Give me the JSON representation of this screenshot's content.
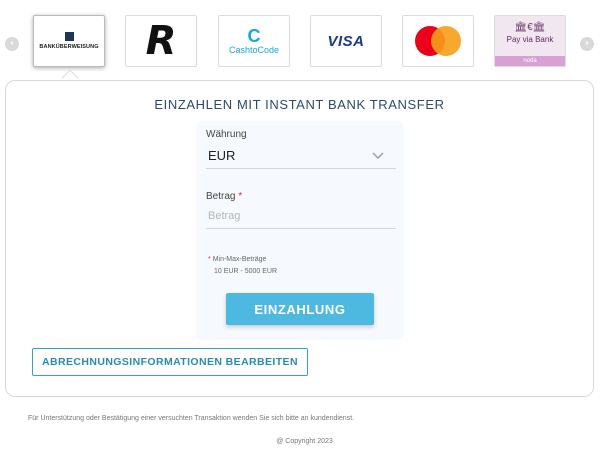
{
  "carousel": {
    "prev_glyph": "‹",
    "next_glyph": "›",
    "methods": [
      {
        "id": "bank-transfer",
        "logo_text": "BANKÜBERWEISUNG",
        "active": true
      },
      {
        "id": "revolut",
        "logo_text": "R",
        "active": false
      },
      {
        "id": "cashtocode",
        "logo_text": "CashtoCode",
        "active": false
      },
      {
        "id": "visa",
        "logo_text": "VISA",
        "active": false
      },
      {
        "id": "mastercard",
        "logo_text": "",
        "active": false
      },
      {
        "id": "pay-via-bank",
        "logo_text": "Pay via Bank",
        "sub_text": "noda",
        "active": false
      }
    ]
  },
  "form": {
    "title": "EINZAHLEN MIT INSTANT BANK TRANSFER",
    "currency_label": "Währung",
    "currency_value": "EUR",
    "amount_label": "Betrag",
    "amount_required_mark": "*",
    "amount_placeholder": "Betrag",
    "limits_mark": "*",
    "limits_title": "Min-Max-Beträge",
    "limits_range": "10 EUR - 5000 EUR",
    "submit_label": "EINZAHLUNG",
    "billing_label": "ABRECHNUNGSINFORMATIONEN BEARBEITEN"
  },
  "footer": {
    "support_note": "Für Unterstützung oder Bestätigung einer versuchten Transaktion wenden Sie sich bitte an kundendienst.",
    "copyright": "@ Copyright 2023"
  },
  "colors": {
    "accent": "#4db8e0",
    "title": "#2b4b6b",
    "billing_border": "#3aa0c8"
  }
}
